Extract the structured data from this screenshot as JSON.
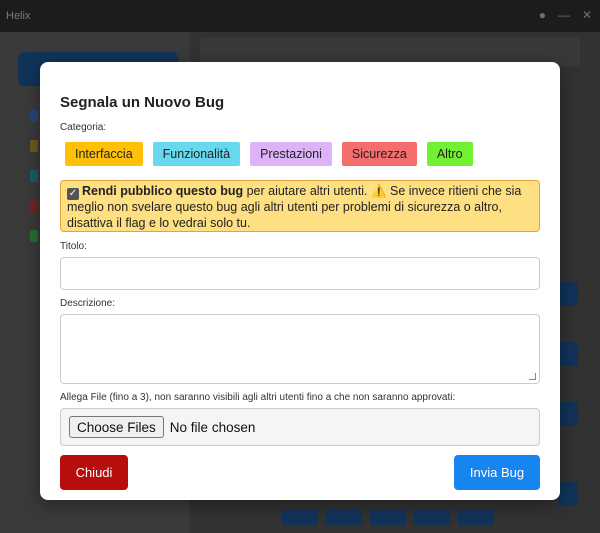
{
  "window": {
    "title": "Helix"
  },
  "modal": {
    "title": "Segnala un Nuovo Bug",
    "category_label": "Categoria:",
    "categories": [
      {
        "label": "Interfaccia",
        "color": "#ffc107"
      },
      {
        "label": "Funzionalità",
        "color": "#66d9ef"
      },
      {
        "label": "Prestazioni",
        "color": "#ddb3f7"
      },
      {
        "label": "Sicurezza",
        "color": "#f46e6e"
      },
      {
        "label": "Altro",
        "color": "#72f032"
      }
    ],
    "public_notice": {
      "checked": true,
      "bold_text": "Rendi pubblico questo bug",
      "text_1": " per aiutare altri utenti. ",
      "warning_icon": "warning-icon",
      "text_2": " Se invece ritieni che sia meglio non svelare questo bug agli altri utenti per problemi di sicurezza o altro, disattiva il flag e lo vedrai solo tu.",
      "background": "#fedf82"
    },
    "title_field": {
      "label": "Titolo:",
      "value": "",
      "placeholder": ""
    },
    "description_field": {
      "label": "Descrizione:",
      "value": "",
      "placeholder": ""
    },
    "attachments": {
      "label": "Allega File (fino a 3), non saranno visibili agli altri utenti fino a che non saranno approvati:",
      "button_label": "Choose Files",
      "status": "No file chosen"
    },
    "close_button": {
      "label": "Chiudi",
      "color": "#b80d0d"
    },
    "send_button": {
      "label": "Invia Bug",
      "color": "#1685f0"
    }
  }
}
